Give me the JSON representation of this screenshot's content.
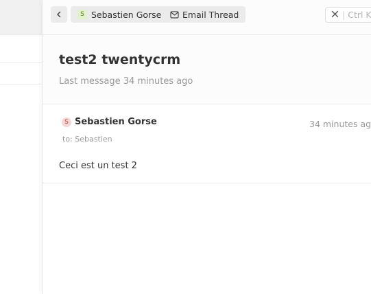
{
  "header": {
    "person_chip": {
      "avatar_letter": "S",
      "name": "Sebastien Gorse"
    },
    "thread_chip": {
      "label": "Email Thread"
    },
    "close_button": {
      "shortcut_label": "Ctrl K"
    }
  },
  "thread": {
    "subject": "test2 twentycrm",
    "last_message": "Last message 34 minutes ago"
  },
  "messages": [
    {
      "avatar_letter": "S",
      "sender": "Sebastien Gorse",
      "time": "34 minutes ago",
      "recipients": "to: Sebastien",
      "body": "Ceci est un test 2"
    }
  ],
  "colors": {
    "person_chip_avatar_bg": "#e3f2cc",
    "message_avatar_bg": "#f6d6d4",
    "chip_bg": "#ebebeb"
  },
  "icons": {
    "back": "chevron-left-icon",
    "thread": "mail-icon",
    "close": "close-icon"
  }
}
